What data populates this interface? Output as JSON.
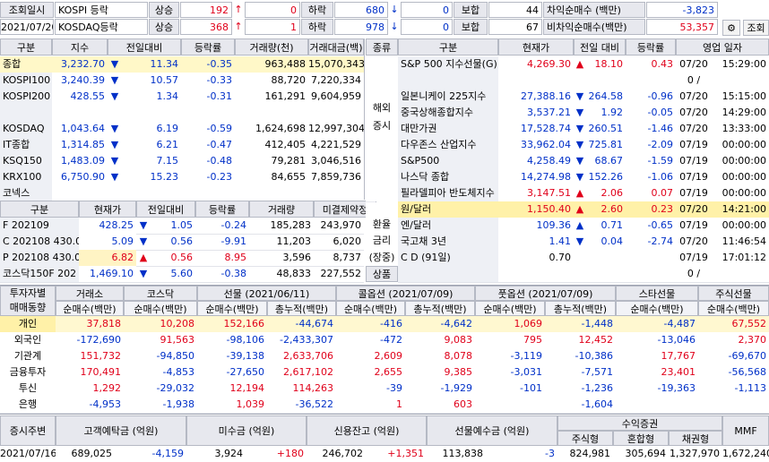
{
  "top": {
    "row1": {
      "date_label": "조회일시",
      "kospi_label": "KOSPI 등락",
      "up_label": "상승",
      "up_val": "192",
      "up_arrow": "↑",
      "limit_up": "0",
      "down_label": "하락",
      "down_val": "680",
      "down_arrow": "↓",
      "limit_down": "0",
      "hold_label": "보합",
      "hold_val": "44",
      "arb_label": "차익순매수 (백만)",
      "arb_val": "-3,823"
    },
    "row2": {
      "date": "2021/07/20",
      "kosdaq_label": "KOSDAQ등락",
      "up_label": "상승",
      "up_val": "368",
      "up_arrow": "↑",
      "limit_up": "1",
      "down_label": "하락",
      "down_val": "978",
      "down_arrow": "↓",
      "limit_down": "0",
      "hold_label": "보합",
      "hold_val": "67",
      "nonarb_label": "비차익순매수(백만)",
      "nonarb_val": "53,357"
    },
    "search_button": "조회"
  },
  "index_table": {
    "headers": [
      "구분",
      "지수",
      "전일대비",
      "등락률",
      "거래량(천)",
      "거래대금(백)"
    ],
    "rows": [
      {
        "name": "종합",
        "value": "3,232.70",
        "arrow": "▼",
        "change": "11.34",
        "rate": "-0.35",
        "volume": "963,488",
        "amount": "15,070,343"
      },
      {
        "name": "KOSPI100",
        "value": "3,240.39",
        "arrow": "▼",
        "change": "10.57",
        "rate": "-0.33",
        "volume": "88,720",
        "amount": "7,220,334"
      },
      {
        "name": "KOSPI200",
        "value": "428.55",
        "arrow": "▼",
        "change": "1.34",
        "rate": "-0.31",
        "volume": "161,291",
        "amount": "9,604,959"
      },
      {
        "name": "",
        "value": "",
        "arrow": "",
        "change": "",
        "rate": "",
        "volume": "",
        "amount": ""
      },
      {
        "name": "KOSDAQ",
        "value": "1,043.64",
        "arrow": "▼",
        "change": "6.19",
        "rate": "-0.59",
        "volume": "1,624,698",
        "amount": "12,997,304"
      },
      {
        "name": "IT종합",
        "value": "1,314.85",
        "arrow": "▼",
        "change": "6.21",
        "rate": "-0.47",
        "volume": "412,405",
        "amount": "4,221,529"
      },
      {
        "name": "KSQ150",
        "value": "1,483.09",
        "arrow": "▼",
        "change": "7.15",
        "rate": "-0.48",
        "volume": "79,281",
        "amount": "3,046,516"
      },
      {
        "name": "KRX100",
        "value": "6,750.90",
        "arrow": "▼",
        "change": "15.23",
        "rate": "-0.23",
        "volume": "84,655",
        "amount": "7,859,736"
      },
      {
        "name": "코넥스",
        "value": "",
        "arrow": "",
        "change": "",
        "rate": "",
        "volume": "",
        "amount": ""
      }
    ]
  },
  "futures_table": {
    "headers": [
      "구분",
      "현재가",
      "전일대비",
      "등락률",
      "거래량",
      "미결제약정"
    ],
    "rows": [
      {
        "name": "F 202109",
        "price": "428.25",
        "arrow": "▼",
        "change": "1.05",
        "rate": "-0.24",
        "volume": "185,283",
        "oi": "243,970"
      },
      {
        "name": "C 202108 430.0",
        "price": "5.09",
        "arrow": "▼",
        "change": "0.56",
        "rate": "-9.91",
        "volume": "11,203",
        "oi": "6,020"
      },
      {
        "name": "P 202108 430.0",
        "price": "6.82",
        "arrow": "▲",
        "change": "0.56",
        "rate": "8.95",
        "volume": "3,596",
        "oi": "8,737"
      },
      {
        "name": "코스닥150F 202",
        "price": "1,469.10",
        "arrow": "▼",
        "change": "5.60",
        "rate": "-0.38",
        "volume": "48,833",
        "oi": "227,552"
      }
    ]
  },
  "world_table": {
    "headers": [
      "종류",
      "구분",
      "현재가",
      "전일 대비",
      "등락률",
      "영업 일자"
    ],
    "group1": "해외\n증시",
    "group2": "환율\n금리",
    "group2b": "(장중)",
    "group3": "상품",
    "rows": [
      {
        "name": "S&P 500 지수선물(G)",
        "price": "4,269.30",
        "arrow": "▲",
        "change": "18.10",
        "rate": "0.43",
        "date": "07/20",
        "time": "15:29:00",
        "color": "red"
      },
      {
        "name": "",
        "price": "",
        "arrow": "",
        "change": "",
        "rate": "",
        "date": "0 /",
        "time": "",
        "color": ""
      },
      {
        "name": "일본니케이 225지수",
        "price": "27,388.16",
        "arrow": "▼",
        "change": "264.58",
        "rate": "-0.96",
        "date": "07/20",
        "time": "15:15:00",
        "color": "blue"
      },
      {
        "name": "중국상해종합지수",
        "price": "3,537.21",
        "arrow": "▼",
        "change": "1.92",
        "rate": "-0.05",
        "date": "07/20",
        "time": "14:29:00",
        "color": "blue"
      },
      {
        "name": "대만가권",
        "price": "17,528.74",
        "arrow": "▼",
        "change": "260.51",
        "rate": "-1.46",
        "date": "07/20",
        "time": "13:33:00",
        "color": "blue"
      },
      {
        "name": "다우존스 산업지수",
        "price": "33,962.04",
        "arrow": "▼",
        "change": "725.81",
        "rate": "-2.09",
        "date": "07/19",
        "time": "00:00:00",
        "color": "blue"
      },
      {
        "name": "S&P500",
        "price": "4,258.49",
        "arrow": "▼",
        "change": "68.67",
        "rate": "-1.59",
        "date": "07/19",
        "time": "00:00:00",
        "color": "blue"
      },
      {
        "name": "나스닥 종합",
        "price": "14,274.98",
        "arrow": "▼",
        "change": "152.26",
        "rate": "-1.06",
        "date": "07/19",
        "time": "00:00:00",
        "color": "blue"
      },
      {
        "name": "필라델피아 반도체지수",
        "price": "3,147.51",
        "arrow": "▲",
        "change": "2.06",
        "rate": "0.07",
        "date": "07/19",
        "time": "00:00:00",
        "color": "red"
      },
      {
        "name": "원/달러",
        "price": "1,150.40",
        "arrow": "▲",
        "change": "2.60",
        "rate": "0.23",
        "date": "07/20",
        "time": "14:21:00",
        "color": "red"
      },
      {
        "name": "엔/달러",
        "price": "109.36",
        "arrow": "▲",
        "change": "0.71",
        "rate": "-0.65",
        "date": "07/19",
        "time": "00:00:00",
        "color": "blue"
      },
      {
        "name": "국고채 3년",
        "price": "1.41",
        "arrow": "▼",
        "change": "0.04",
        "rate": "-2.74",
        "date": "07/20",
        "time": "11:46:54",
        "color": "blue"
      },
      {
        "name": "C D (91일)",
        "price": "0.70",
        "arrow": "",
        "change": "",
        "rate": "",
        "date": "07/19",
        "time": "17:01:12",
        "color": ""
      },
      {
        "name": "",
        "price": "",
        "arrow": "",
        "change": "",
        "rate": "",
        "date": "0 /",
        "time": "",
        "color": ""
      }
    ]
  },
  "investor_table": {
    "corner": [
      "투자자별",
      "매매동향"
    ],
    "groups": [
      "거래소",
      "코스닥",
      "선물   (2021/06/11)",
      "콜옵션   (2021/07/09)",
      "풋옵션   (2021/07/09)",
      "스타선물",
      "주식선물"
    ],
    "sub_net": "순매수(백만)",
    "sub_cum": "총누적(백만)",
    "rows": [
      {
        "name": "개인",
        "v": [
          "37,818",
          "10,208",
          "152,166",
          "-44,674",
          "-416",
          "-4,642",
          "1,069",
          "-1,448",
          "-4,487",
          "67,552"
        ]
      },
      {
        "name": "외국인",
        "v": [
          "-172,690",
          "91,563",
          "-98,106",
          "-2,433,307",
          "-472",
          "9,083",
          "795",
          "12,452",
          "-13,046",
          "2,370"
        ]
      },
      {
        "name": "기관계",
        "v": [
          "151,732",
          "-94,850",
          "-39,138",
          "2,633,706",
          "2,609",
          "8,078",
          "-3,119",
          "-10,386",
          "17,767",
          "-69,670"
        ]
      },
      {
        "name": "금융투자",
        "v": [
          "170,491",
          "-4,853",
          "-27,650",
          "2,617,102",
          "2,655",
          "9,385",
          "-3,031",
          "-7,571",
          "23,401",
          "-56,568"
        ]
      },
      {
        "name": "투신",
        "v": [
          "1,292",
          "-29,032",
          "12,194",
          "114,263",
          "-39",
          "-1,929",
          "-101",
          "-1,236",
          "-19,363",
          "-1,113"
        ]
      },
      {
        "name": "은행",
        "v": [
          "-4,953",
          "-1,938",
          "1,039",
          "-36,522",
          "1",
          "603",
          "",
          "-1,604",
          "",
          ""
        ]
      }
    ]
  },
  "bottom_table": {
    "headers": [
      "증시주변",
      "고객예탁금  (억원)",
      "미수금  (억원)",
      "신용잔고  (억원)",
      "선물예수금  (억원)",
      "수익증권",
      "MMF"
    ],
    "sub": [
      "주식형",
      "혼합형",
      "채권형"
    ],
    "row": {
      "date": "2021/07/16",
      "deposit": "689,025",
      "deposit_chg": "-4,159",
      "unpaid": "3,924",
      "unpaid_chg": "+180",
      "credit": "246,702",
      "credit_chg": "+1,351",
      "fut_dep": "113,838",
      "fut_dep_chg": "-3",
      "stock": "824,981",
      "mixed": "305,694",
      "bond": "1,327,970",
      "mmf": "1,672,240"
    }
  }
}
